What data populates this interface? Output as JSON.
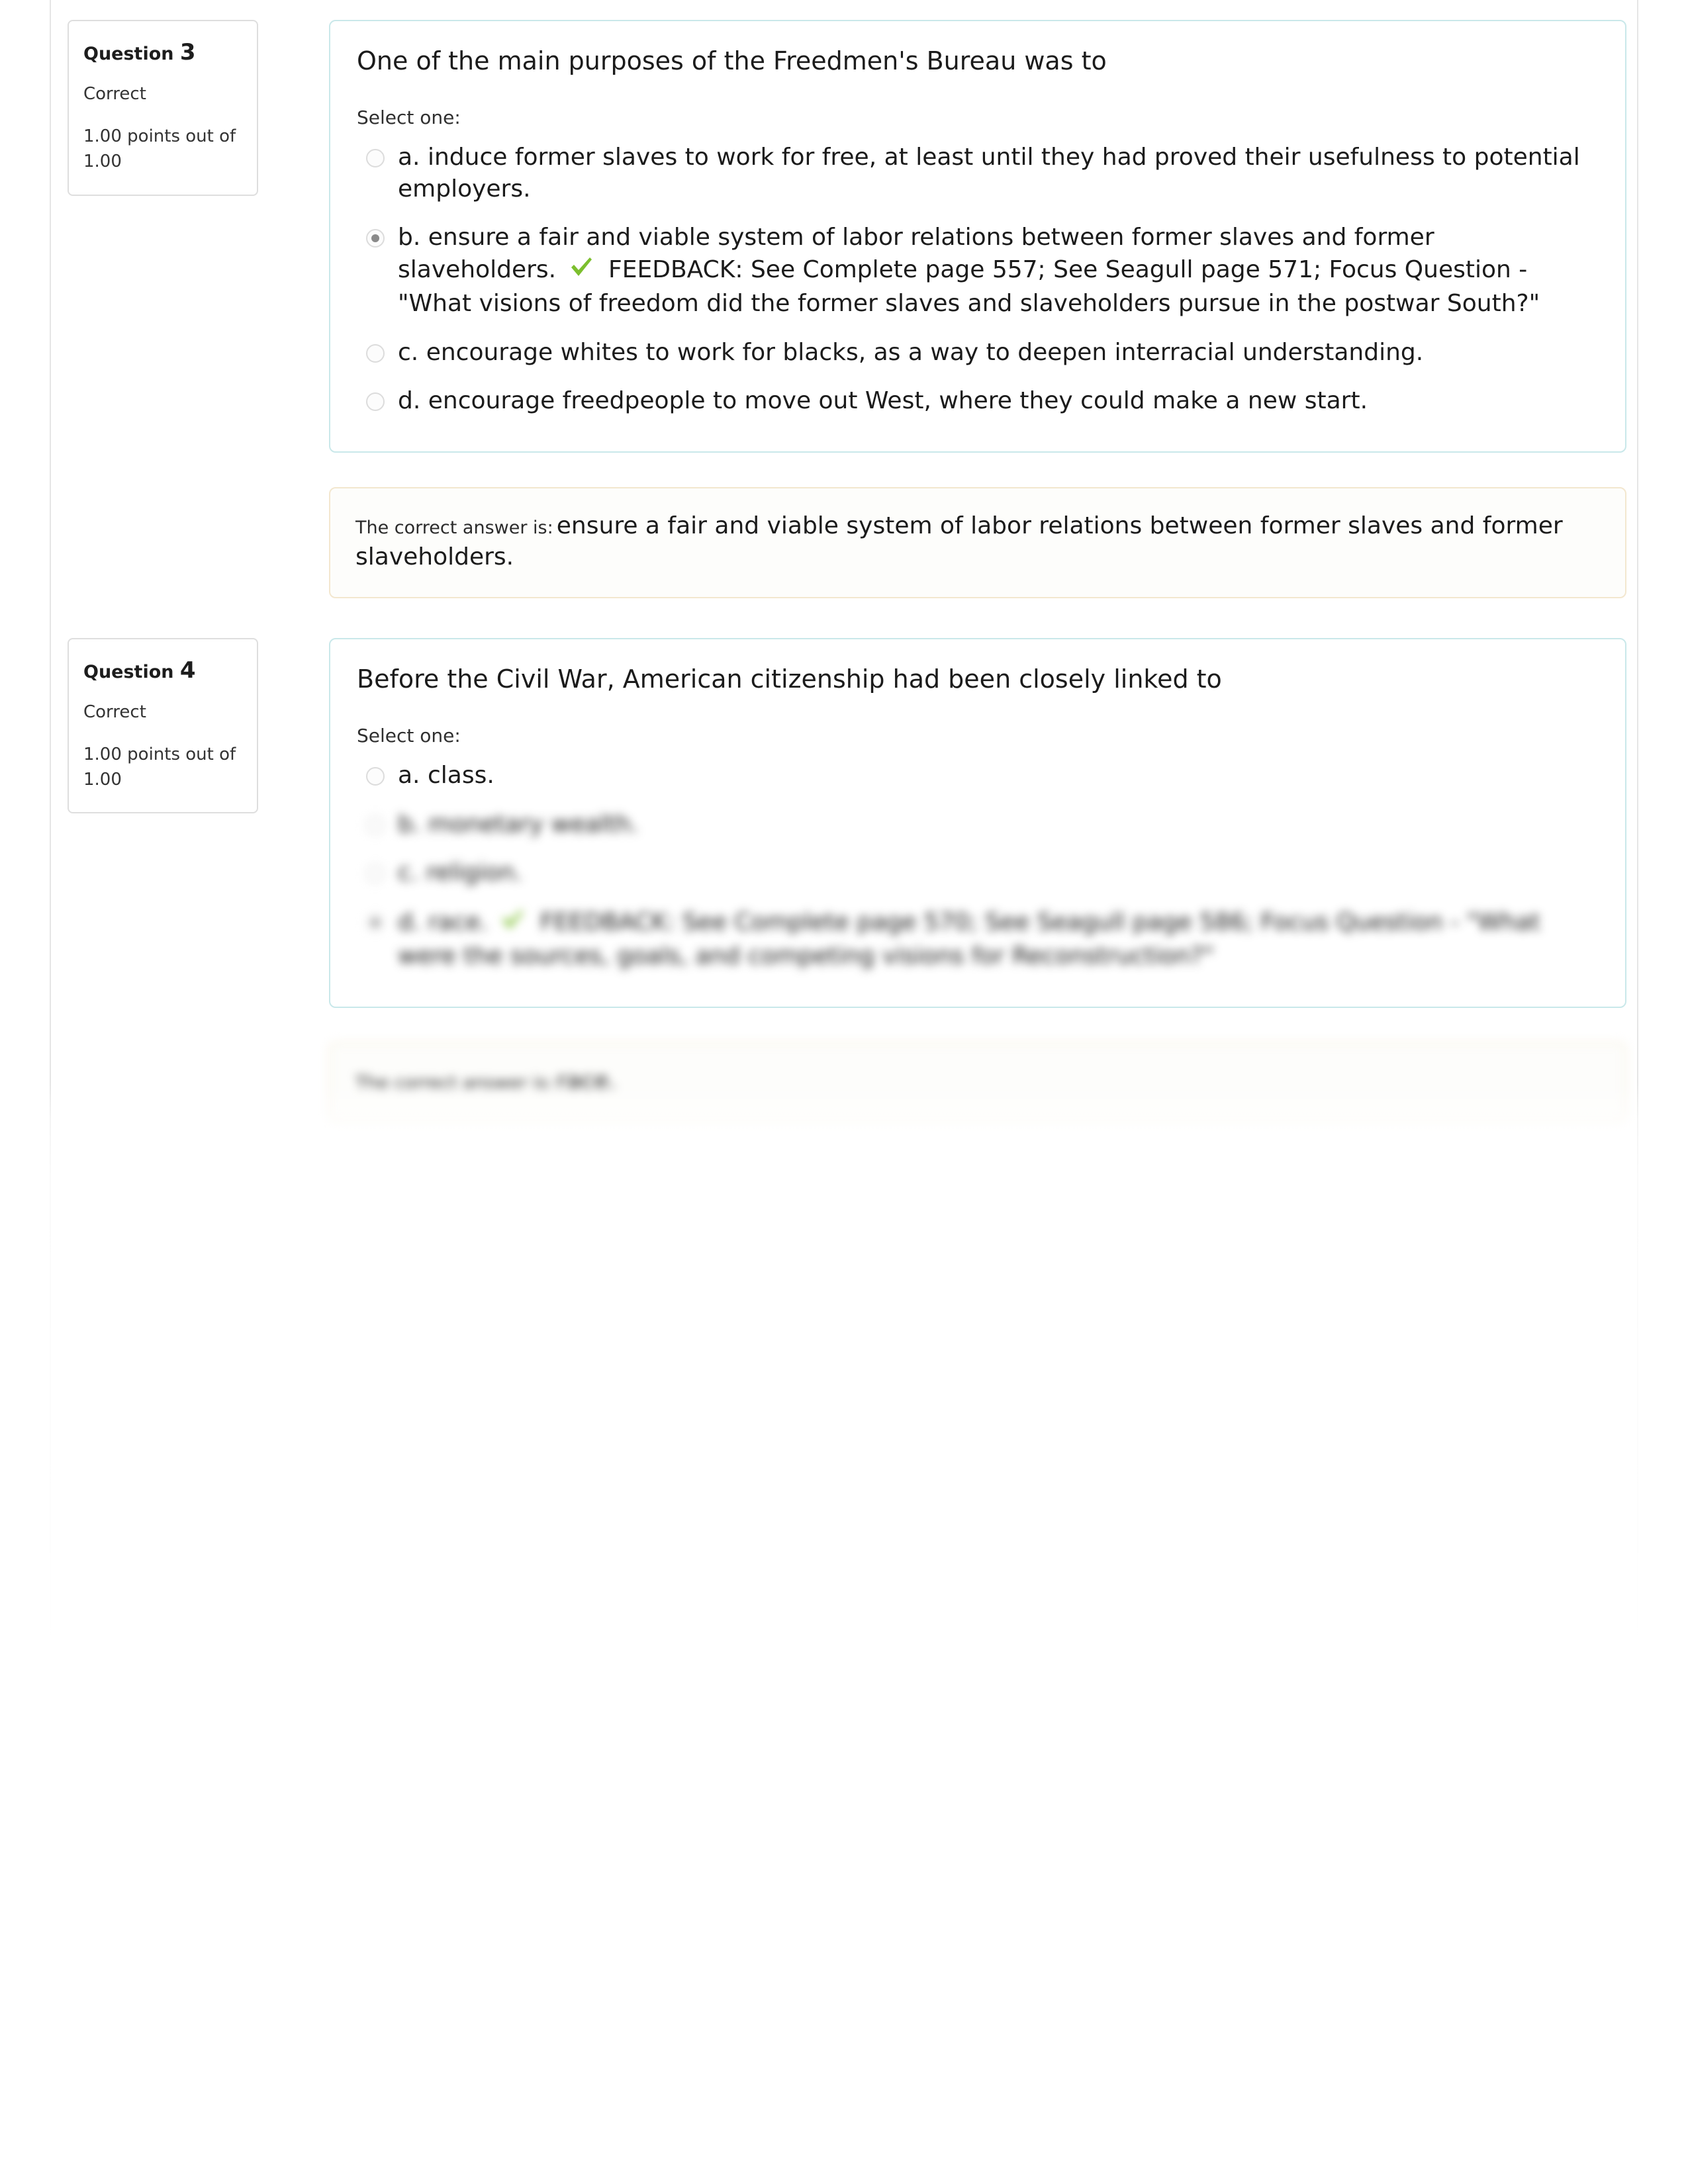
{
  "questions": [
    {
      "info": {
        "label": "Question",
        "number": "3",
        "state": "Correct",
        "grade": "1.00 points out of 1.00"
      },
      "stem": "One of the main purposes of the Freedmen's Bureau was to",
      "select_prompt": "Select one:",
      "answers": [
        {
          "key": "a.",
          "text": "induce former slaves to work for free, at least until they had proved their usefulness to potential employers.",
          "selected": false,
          "correct_mark": false
        },
        {
          "key": "b.",
          "text": "ensure a fair and viable system of labor relations between former slaves and former slaveholders.",
          "feedback": "FEEDBACK: See Complete page 557; See Seagull page 571; Focus Question - \"What visions of freedom did the former slaves and slaveholders pursue in the postwar South?\"",
          "selected": true,
          "correct_mark": true
        },
        {
          "key": "c.",
          "text": "encourage whites to work for blacks, as a way to deepen interracial understanding.",
          "selected": false,
          "correct_mark": false
        },
        {
          "key": "d.",
          "text": "encourage freedpeople to move out West, where they could make a new start.",
          "selected": false,
          "correct_mark": false
        }
      ],
      "feedback_box": {
        "lead": "The correct answer is:",
        "answer": "ensure a fair and viable system of labor relations between former slaves and former slaveholders."
      }
    },
    {
      "info": {
        "label": "Question",
        "number": "4",
        "state": "Correct",
        "grade": "1.00 points out of 1.00"
      },
      "stem": "Before the Civil War, American citizenship had been closely linked to",
      "select_prompt": "Select one:",
      "answers": [
        {
          "key": "a.",
          "text": "class.",
          "selected": false,
          "correct_mark": false
        },
        {
          "key": "b.",
          "text": "monetary wealth.",
          "selected": false,
          "correct_mark": false
        },
        {
          "key": "c.",
          "text": "religion.",
          "selected": false,
          "correct_mark": false
        },
        {
          "key": "d.",
          "text": "race.",
          "feedback": "FEEDBACK: See Complete page 570; See Seagull page 586; Focus Question - \"What were the sources, goals, and competing visions for Reconstruction?\"",
          "selected": true,
          "correct_mark": true
        }
      ],
      "feedback_box": {
        "lead": "The correct answer is:",
        "answer": "race."
      }
    }
  ],
  "colors": {
    "question_border": "#c9e8ea",
    "info_border": "#dedede",
    "feedback_border": "#f3e7cf",
    "check_green": "#7cbf2e",
    "page_rule": "#e6e6e6"
  }
}
